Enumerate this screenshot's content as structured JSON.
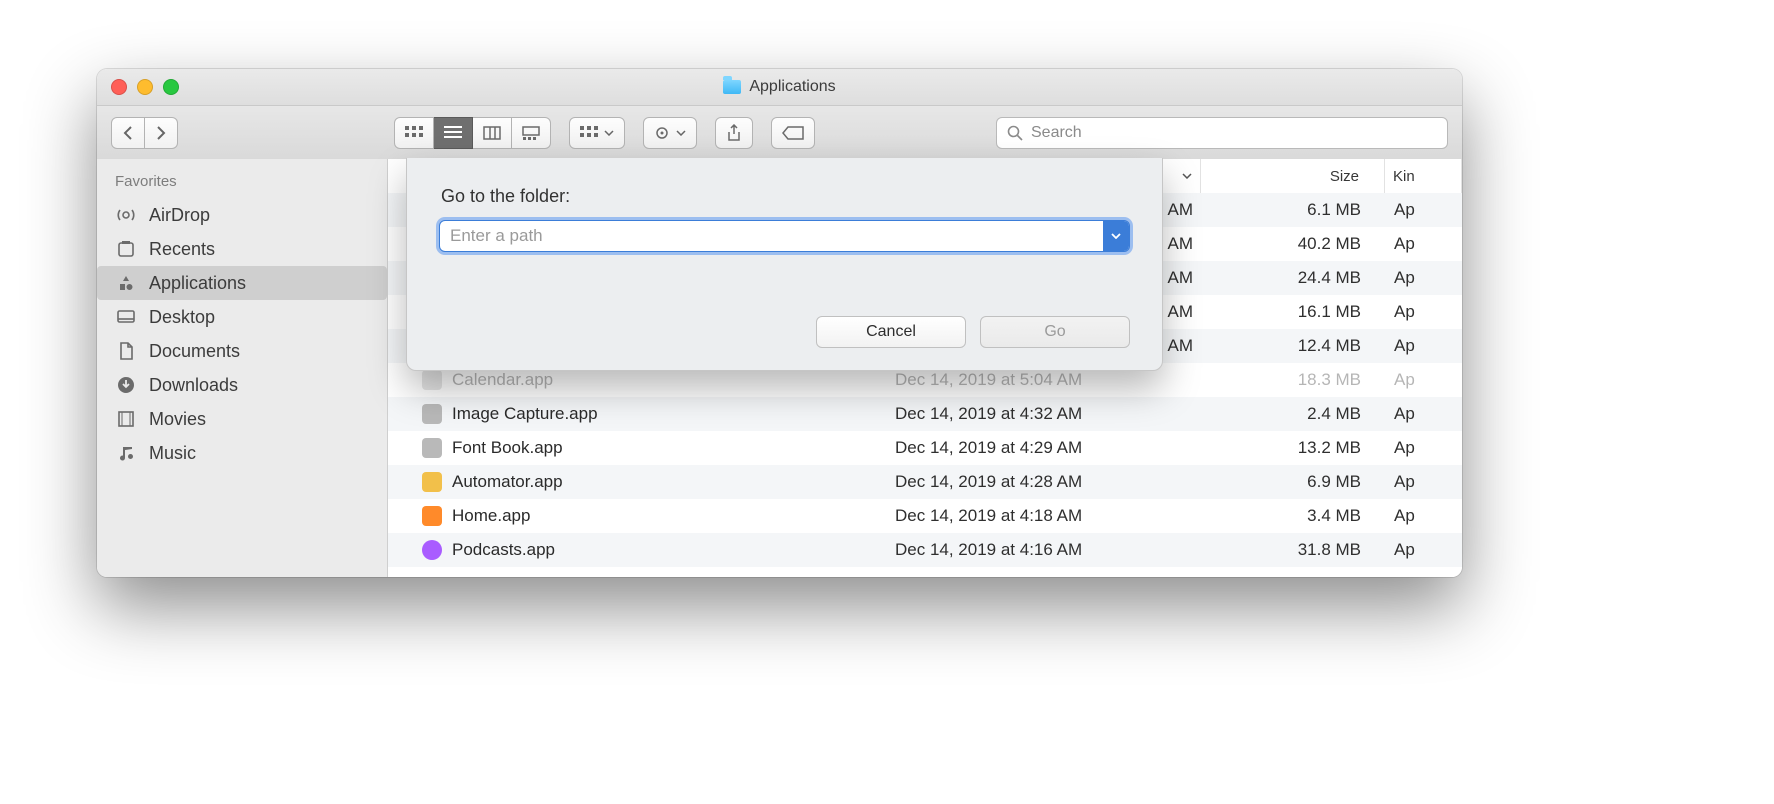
{
  "window": {
    "title": "Applications"
  },
  "toolbar": {
    "search_placeholder": "Search"
  },
  "sidebar": {
    "heading": "Favorites",
    "items": [
      {
        "label": "AirDrop",
        "icon": "airdrop-icon"
      },
      {
        "label": "Recents",
        "icon": "recents-icon"
      },
      {
        "label": "Applications",
        "icon": "apps-icon",
        "selected": true
      },
      {
        "label": "Desktop",
        "icon": "desktop-icon"
      },
      {
        "label": "Documents",
        "icon": "documents-icon"
      },
      {
        "label": "Downloads",
        "icon": "downloads-icon"
      },
      {
        "label": "Movies",
        "icon": "movies-icon"
      },
      {
        "label": "Music",
        "icon": "music-icon"
      }
    ]
  },
  "columns": {
    "modified": "",
    "size": "Size",
    "kind": "Kin"
  },
  "hidden_rows": [
    {
      "modified_tail": "AM",
      "size": "6.1 MB",
      "kind": "Ap"
    },
    {
      "modified_tail": "AM",
      "size": "40.2 MB",
      "kind": "Ap"
    },
    {
      "modified_tail": "AM",
      "size": "24.4 MB",
      "kind": "Ap"
    },
    {
      "modified_tail": "AM",
      "size": "16.1 MB",
      "kind": "Ap"
    },
    {
      "modified_tail": "AM",
      "size": "12.4 MB",
      "kind": "Ap"
    }
  ],
  "partial_row": {
    "name": "Calendar.app",
    "modified": "Dec 14, 2019 at 5:04 AM",
    "size": "18.3 MB",
    "kind": "Ap",
    "icon": "grey"
  },
  "rows": [
    {
      "name": "Image Capture.app",
      "modified": "Dec 14, 2019 at 4:32 AM",
      "size": "2.4 MB",
      "kind": "Ap",
      "icon": "grey"
    },
    {
      "name": "Font Book.app",
      "modified": "Dec 14, 2019 at 4:29 AM",
      "size": "13.2 MB",
      "kind": "Ap",
      "icon": "grey"
    },
    {
      "name": "Automator.app",
      "modified": "Dec 14, 2019 at 4:28 AM",
      "size": "6.9 MB",
      "kind": "Ap",
      "icon": "yellow"
    },
    {
      "name": "Home.app",
      "modified": "Dec 14, 2019 at 4:18 AM",
      "size": "3.4 MB",
      "kind": "Ap",
      "icon": "orange"
    },
    {
      "name": "Podcasts.app",
      "modified": "Dec 14, 2019 at 4:16 AM",
      "size": "31.8 MB",
      "kind": "Ap",
      "icon": "purple"
    }
  ],
  "sheet": {
    "label": "Go to the folder:",
    "placeholder": "Enter a path",
    "cancel": "Cancel",
    "go": "Go"
  }
}
